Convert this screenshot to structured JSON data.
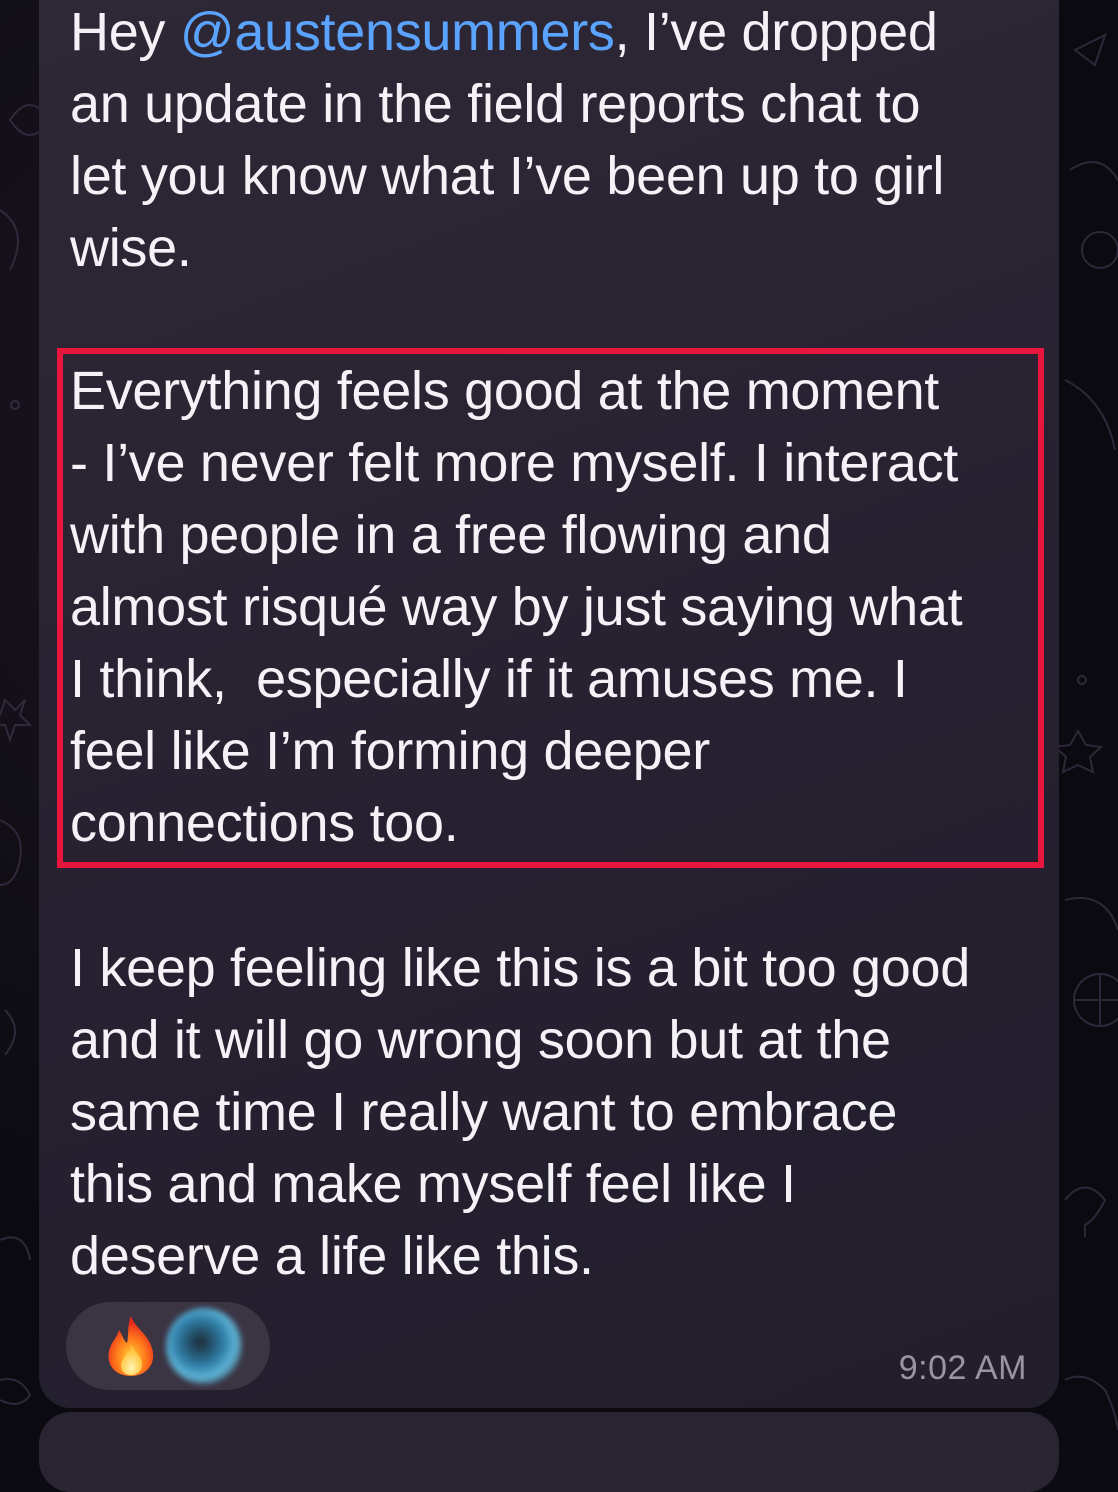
{
  "message": {
    "paragraph1": {
      "prefix": "Hey ",
      "mention": "@austensummers",
      "suffix": ", I’ve dropped\nan update in the field reports chat to\nlet you know what I’ve been up to girl\nwise."
    },
    "paragraph2": "Everything feels good at the moment\n- I’ve never felt more myself. I interact\nwith people in a free flowing and\nalmost risqué way by just saying what\nI think,  especially if it amuses me. I\nfeel like I’m forming deeper\nconnections too.",
    "paragraph3": "I keep feeling like this is a bit too good\nand it will go wrong soon but at the\nsame time I really want to embrace\nthis and make myself feel like I\ndeserve a life like this.",
    "time": "9:02 AM"
  },
  "reactions": [
    {
      "emoji": "fire-icon",
      "reactor": "avatar-blurred"
    }
  ],
  "colors": {
    "bubble": "#2a2432",
    "text": "#f4f2f7",
    "mention": "#5aa3ff",
    "highlight": "#e8153d",
    "timestamp": "#9a93a4"
  }
}
